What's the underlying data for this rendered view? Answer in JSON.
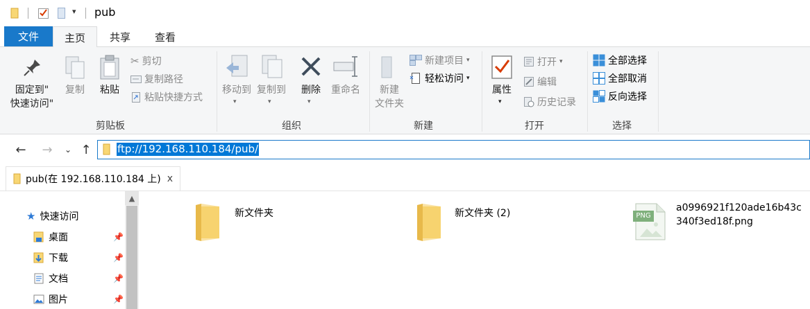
{
  "window": {
    "title": "pub"
  },
  "ribbon_tabs": {
    "file": "文件",
    "home": "主页",
    "share": "共享",
    "view": "查看"
  },
  "clipboard": {
    "pin_label_1": "固定到\"",
    "pin_label_2": "快速访问\"",
    "copy": "复制",
    "paste": "粘贴",
    "cut": "剪切",
    "copy_path": "复制路径",
    "paste_shortcut": "粘贴快捷方式",
    "group": "剪贴板"
  },
  "organize": {
    "move_to": "移动到",
    "copy_to": "复制到",
    "delete": "删除",
    "rename": "重命名",
    "group": "组织"
  },
  "new": {
    "new_folder_1": "新建",
    "new_folder_2": "文件夹",
    "new_item": "新建项目",
    "easy_access": "轻松访问",
    "group": "新建"
  },
  "open": {
    "properties": "属性",
    "open": "打开",
    "edit": "编辑",
    "history": "历史记录",
    "group": "打开"
  },
  "select": {
    "select_all": "全部选择",
    "select_none": "全部取消",
    "invert": "反向选择",
    "group": "选择"
  },
  "address": {
    "path": "ftp://192.168.110.184/pub/"
  },
  "doc_tab": {
    "label": "pub(在 192.168.110.184 上)",
    "close": "x"
  },
  "nav": {
    "quick_access": "快速访问",
    "items": [
      {
        "label": "桌面"
      },
      {
        "label": "下载"
      },
      {
        "label": "文档"
      },
      {
        "label": "图片"
      }
    ]
  },
  "files": [
    {
      "name": "新文件夹",
      "type": "folder"
    },
    {
      "name": "新文件夹 (2)",
      "type": "folder"
    },
    {
      "name_line1": "a0996921f120ade16b43c",
      "name_line2": "340f3ed18f.png",
      "type": "png",
      "badge": "PNG"
    }
  ],
  "colors": {
    "accent": "#1979ca",
    "folder": "#f8d775",
    "folder_dark": "#e8b94a",
    "selection": "#0078d7"
  }
}
